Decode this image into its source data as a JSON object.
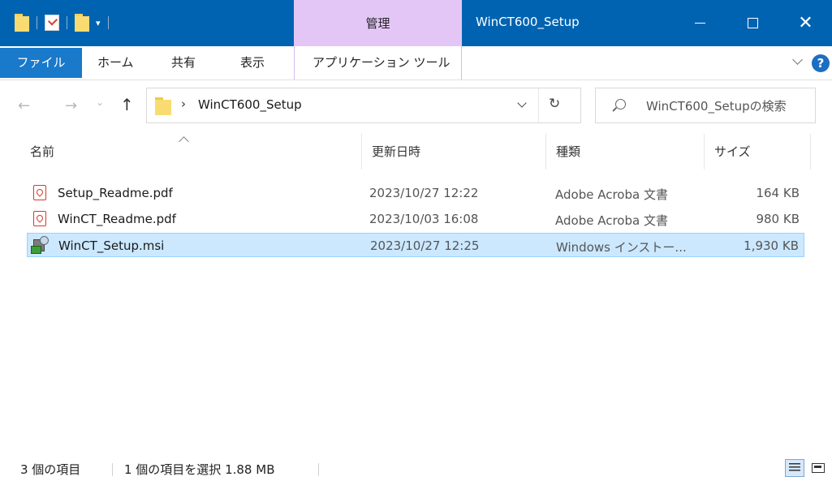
{
  "window": {
    "title": "WinCT600_Setup",
    "context_tab": "管理",
    "title_bar_color": "#0063b1",
    "context_tab_color": "#e3c6f5"
  },
  "ribbon": {
    "tabs": [
      "ファイル",
      "ホーム",
      "共有",
      "表示"
    ],
    "context_tab": "アプリケーション ツール"
  },
  "address": {
    "path": "WinCT600_Setup",
    "search_placeholder": "WinCT600_Setupの検索"
  },
  "columns": {
    "name": "名前",
    "date": "更新日時",
    "type": "種類",
    "size": "サイズ"
  },
  "files": [
    {
      "name": "Setup_Readme.pdf",
      "date": "2023/10/27 12:22",
      "type": "Adobe Acroba 文書",
      "size": "164 KB",
      "icon": "pdf-icon"
    },
    {
      "name": "WinCT_Readme.pdf",
      "date": "2023/10/03 16:08",
      "type": "Adobe Acroba 文書",
      "size": "980 KB",
      "icon": "pdf-icon"
    },
    {
      "name": "WinCT_Setup.msi",
      "date": "2023/10/27 12:25",
      "type": "Windows インストー...",
      "size": "1,930 KB",
      "icon": "installer-icon",
      "selected": true
    }
  ],
  "status": {
    "count": "3 個の項目",
    "selection": "1 個の項目を選択  1.88 MB"
  }
}
